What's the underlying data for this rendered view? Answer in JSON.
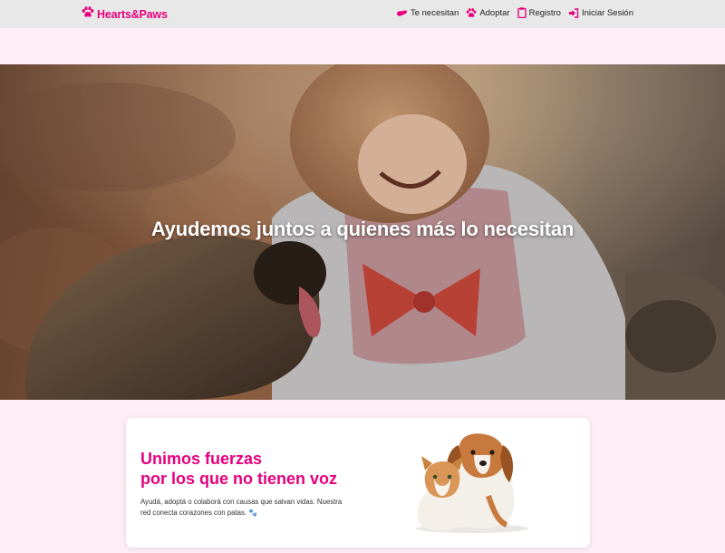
{
  "nav": {
    "brand": "Hearts&Paws",
    "links": [
      {
        "label": "Te necesitan",
        "icon": "heart-hand-icon"
      },
      {
        "label": "Adoptar",
        "icon": "paw-icon"
      },
      {
        "label": "Registro",
        "icon": "clipboard-icon"
      },
      {
        "label": "Iniciar Sesión",
        "icon": "sign-in-icon"
      }
    ]
  },
  "hero": {
    "title": "Ayudemos juntos a quienes más lo necesitan"
  },
  "card": {
    "heading_line1": "Unimos fuerzas",
    "heading_line2": "por los que no tienen voz",
    "text": "Ayudá, adoptá o colaborá con causas que salvan vidas. Nuestra red conecta corazones con patas. 🐾"
  },
  "colors": {
    "brand": "#e6007e",
    "navbar_bg": "#e8e8e8",
    "page_bg": "#fdeef6"
  }
}
